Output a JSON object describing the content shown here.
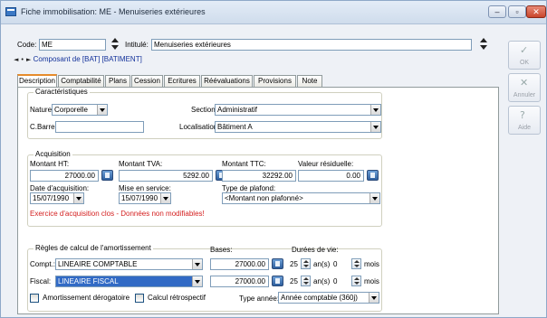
{
  "window": {
    "title": "Fiche immobilisation: ME - Menuiseries extérieures",
    "minimize": "–",
    "maximize": "▫",
    "close": "✕"
  },
  "header": {
    "code_label": "Code:",
    "code_value": "ME",
    "intitule_label": "Intitulé:",
    "intitule_value": "Menuiseries extérieures",
    "nav_text": "Composant de [BAT] [BATIMENT]"
  },
  "side_buttons": {
    "ok": "OK",
    "annuler": "Annuler",
    "aide": "Aide"
  },
  "tabs": [
    "Description",
    "Comptabilité",
    "Plans",
    "Cession",
    "Ecritures",
    "Réévaluations",
    "Provisions",
    "Note"
  ],
  "caracteristiques": {
    "title": "Caractéristiques",
    "nature_label": "Nature:",
    "nature_value": "Corporelle",
    "section_label": "Section:",
    "section_value": "Administratif",
    "cbarre_label": "C.Barre:",
    "cbarre_value": "",
    "localisation_label": "Localisation:",
    "localisation_value": "Bâtiment A"
  },
  "acquisition": {
    "title": "Acquisition",
    "montant_ht_label": "Montant HT:",
    "montant_ht_value": "27000.00",
    "montant_tva_label": "Montant TVA:",
    "montant_tva_value": "5292.00",
    "montant_ttc_label": "Montant TTC:",
    "montant_ttc_value": "32292.00",
    "valeur_residuelle_label": "Valeur résiduelle:",
    "valeur_residuelle_value": "0.00",
    "date_acquisition_label": "Date d'acquisition:",
    "date_acquisition_value": "15/07/1990",
    "mise_en_service_label": "Mise en service:",
    "mise_en_service_value": "15/07/1990",
    "type_plafond_label": "Type de plafond:",
    "type_plafond_value": "<Montant non plafonné>",
    "warning": "Exercice d'acquisition clos - Données non modifiables!"
  },
  "amortissement": {
    "title": "Règles de calcul de l'amortissement",
    "bases_label": "Bases:",
    "durees_label": "Durées de vie:",
    "compt_label": "Compt.:",
    "compt_value": "LINEAIRE COMPTABLE",
    "compt_base": "27000.00",
    "compt_annees": "25",
    "compt_mois": "0",
    "fiscal_label": "Fiscal:",
    "fiscal_value": "LINEAIRE FISCAL",
    "fiscal_base": "27000.00",
    "fiscal_annees": "25",
    "fiscal_mois": "0",
    "ans_label": "an(s)",
    "mois_label": "mois",
    "derogatoire_label": "Amortissement dérogatoire",
    "retrospectif_label": "Calcul rétrospectif",
    "type_annee_label": "Type année:",
    "type_annee_value": "Année comptable (360j)"
  }
}
